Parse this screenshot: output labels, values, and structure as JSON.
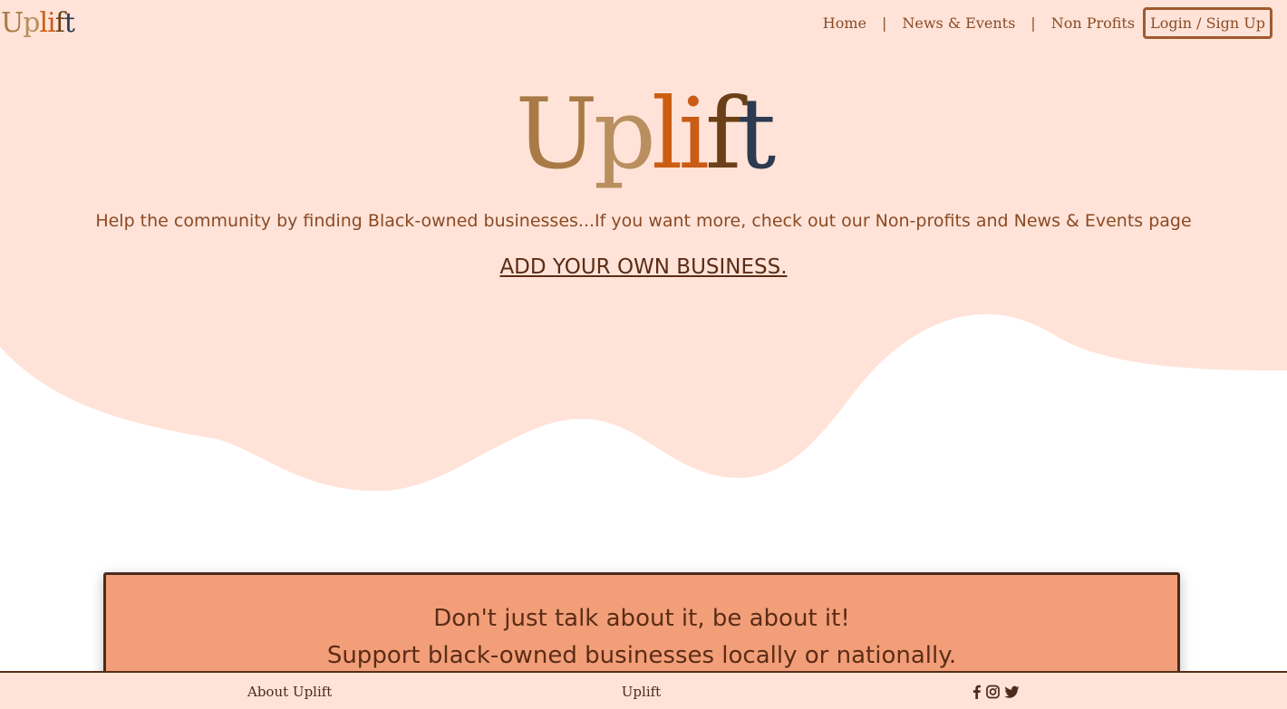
{
  "brand": {
    "letters": [
      "U",
      "p",
      "l",
      "i",
      "f",
      "t"
    ],
    "colors": [
      "#a87a45",
      "#b98f60",
      "#cc5e12",
      "#c95c16",
      "#6b4018",
      "#2c3b50"
    ]
  },
  "nav": {
    "home": "Home",
    "news": "News & Events",
    "nonprofits": "Non Profits",
    "login": "Login / Sign Up",
    "separator": "|"
  },
  "hero": {
    "title_letters": [
      "U",
      "p",
      "l",
      "i",
      "f",
      "t"
    ],
    "tagline": "Help the community by finding Black-owned businesses...If you want more, check out our Non-profits and News & Events page",
    "cta": "ADD YOUR OWN BUSINESS."
  },
  "promo": {
    "line1": "Don't just talk about it, be about it!",
    "line2": "Support black-owned businesses locally or nationally."
  },
  "footer": {
    "about": "About Uplift",
    "brand": "Uplift",
    "social_icons": [
      "facebook-icon",
      "instagram-icon",
      "twitter-icon"
    ]
  },
  "colors": {
    "hero_background": "#ffe3d8",
    "accent": "#8a4a24",
    "promo_background": "#f29f79",
    "dark_brown": "#5b2c16"
  }
}
